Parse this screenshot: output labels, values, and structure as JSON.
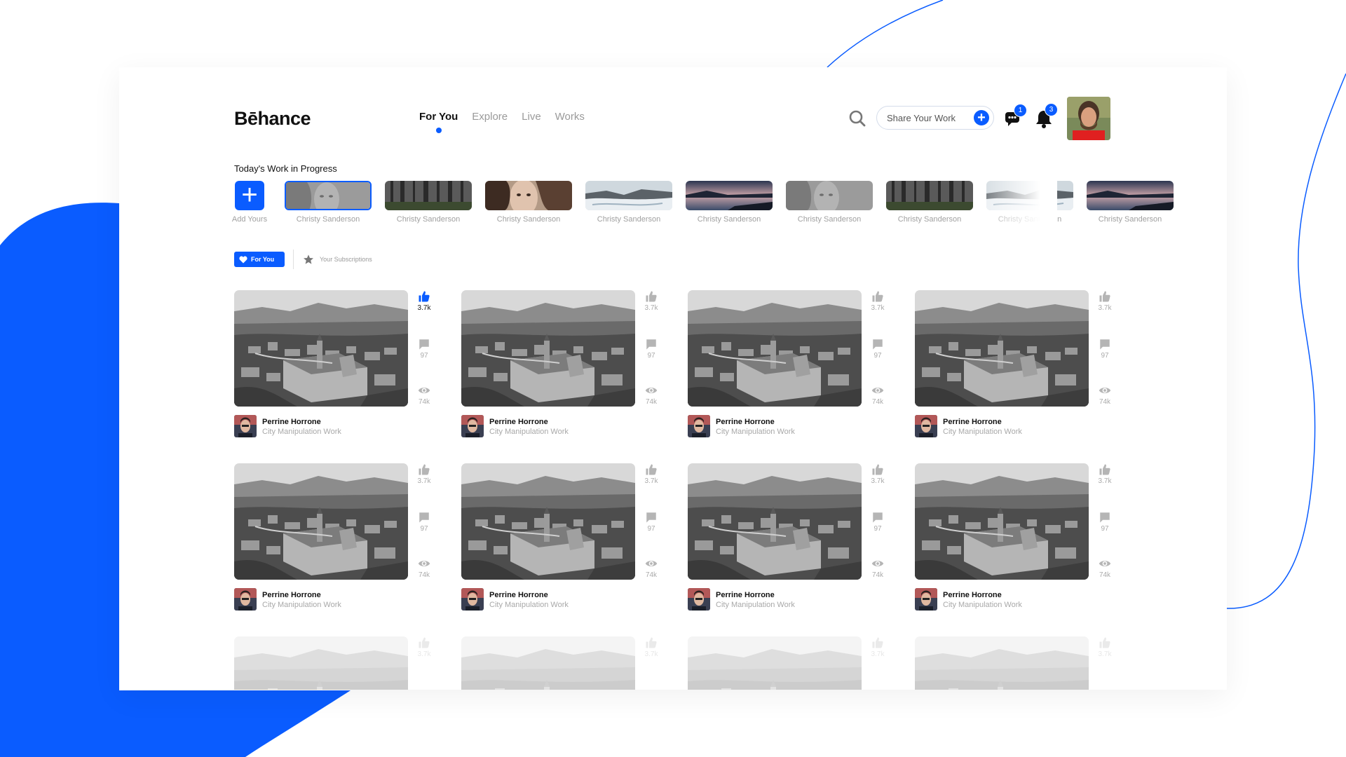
{
  "colors": {
    "accent": "#0a5cff",
    "text": "#111111",
    "muted": "#9a9a9a"
  },
  "header": {
    "logo": "Bēhance",
    "nav": [
      {
        "label": "For You",
        "active": true
      },
      {
        "label": "Explore",
        "active": false
      },
      {
        "label": "Live",
        "active": false
      },
      {
        "label": "Works",
        "active": false
      }
    ],
    "search_icon": "search-icon",
    "share_label": "Share Your Work",
    "messages_badge": "1",
    "notifications_badge": "3"
  },
  "stories": {
    "title": "Today's Work in Progress",
    "add_label": "Add Yours",
    "items": [
      {
        "label": "Christy Sanderson",
        "kind": "portrait-gray",
        "selected": true
      },
      {
        "label": "Christy Sanderson",
        "kind": "forest"
      },
      {
        "label": "Christy Sanderson",
        "kind": "portrait"
      },
      {
        "label": "Christy Sanderson",
        "kind": "waterfall"
      },
      {
        "label": "Christy Sanderson",
        "kind": "sunset"
      },
      {
        "label": "Christy Sanderson",
        "kind": "portrait-gray"
      },
      {
        "label": "Christy Sanderson",
        "kind": "forest"
      },
      {
        "label": "Christy Sanderson",
        "kind": "waterfall"
      },
      {
        "label": "Christy Sanderson",
        "kind": "sunset"
      }
    ]
  },
  "filters": {
    "for_you": "For You",
    "subscriptions": "Your Subscriptions"
  },
  "posts": [
    {
      "author": "Perrine Horrone",
      "subtitle": "City Manipulation Work",
      "likes": "3.7k",
      "comments": "97",
      "views": "74k",
      "liked": true
    },
    {
      "author": "Perrine Horrone",
      "subtitle": "City Manipulation Work",
      "likes": "3.7k",
      "comments": "97",
      "views": "74k",
      "liked": false
    },
    {
      "author": "Perrine Horrone",
      "subtitle": "City Manipulation Work",
      "likes": "3.7k",
      "comments": "97",
      "views": "74k",
      "liked": false
    },
    {
      "author": "Perrine Horrone",
      "subtitle": "City Manipulation Work",
      "likes": "3.7k",
      "comments": "97",
      "views": "74k",
      "liked": false
    },
    {
      "author": "Perrine Horrone",
      "subtitle": "City Manipulation Work",
      "likes": "3.7k",
      "comments": "97",
      "views": "74k",
      "liked": false
    },
    {
      "author": "Perrine Horrone",
      "subtitle": "City Manipulation Work",
      "likes": "3.7k",
      "comments": "97",
      "views": "74k",
      "liked": false
    },
    {
      "author": "Perrine Horrone",
      "subtitle": "City Manipulation Work",
      "likes": "3.7k",
      "comments": "97",
      "views": "74k",
      "liked": false
    },
    {
      "author": "Perrine Horrone",
      "subtitle": "City Manipulation Work",
      "likes": "3.7k",
      "comments": "97",
      "views": "74k",
      "liked": false
    },
    {
      "likes": "3.7k",
      "liked": false
    },
    {
      "likes": "3.7k",
      "liked": false
    },
    {
      "likes": "3.7k",
      "liked": false
    },
    {
      "likes": "3.7k",
      "liked": false
    }
  ]
}
